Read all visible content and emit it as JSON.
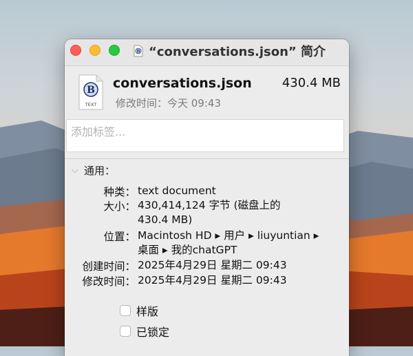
{
  "window": {
    "title": "“conversations.json” 简介",
    "controls": {
      "close": "close-button",
      "minimize": "minimize-button",
      "zoom": "zoom-button"
    }
  },
  "header": {
    "file_name": "conversations.json",
    "file_size": "430.4 MB",
    "modified": "修改时间：今天 09:43",
    "icon_label": "TEXT"
  },
  "tags": {
    "placeholder": "添加标签..."
  },
  "general": {
    "section_label": "通用：",
    "rows": [
      {
        "label": "种类：",
        "value": "text document"
      },
      {
        "label": "大小：",
        "value_line1": "430,414,124 字节 (磁盘上的",
        "value_line2": "430.4 MB)"
      },
      {
        "label": "位置：",
        "value_line1": "Macintosh HD ▸ 用户 ▸ liuyuntian ▸",
        "value_line2": "桌面 ▸ 我的chatGPT"
      },
      {
        "label": "创建时间：",
        "value": "2025年4月29日 星期二 09:43"
      },
      {
        "label": "修改时间：",
        "value": "2025年4月29日 星期二 09:43"
      }
    ]
  },
  "checkboxes": [
    {
      "label": "样版",
      "checked": false
    },
    {
      "label": "已锁定",
      "checked": false
    }
  ],
  "colors": {
    "close": "#fe5f57",
    "minimize": "#febc2e",
    "zoom": "#28c840",
    "window_bg": "#ececec"
  }
}
